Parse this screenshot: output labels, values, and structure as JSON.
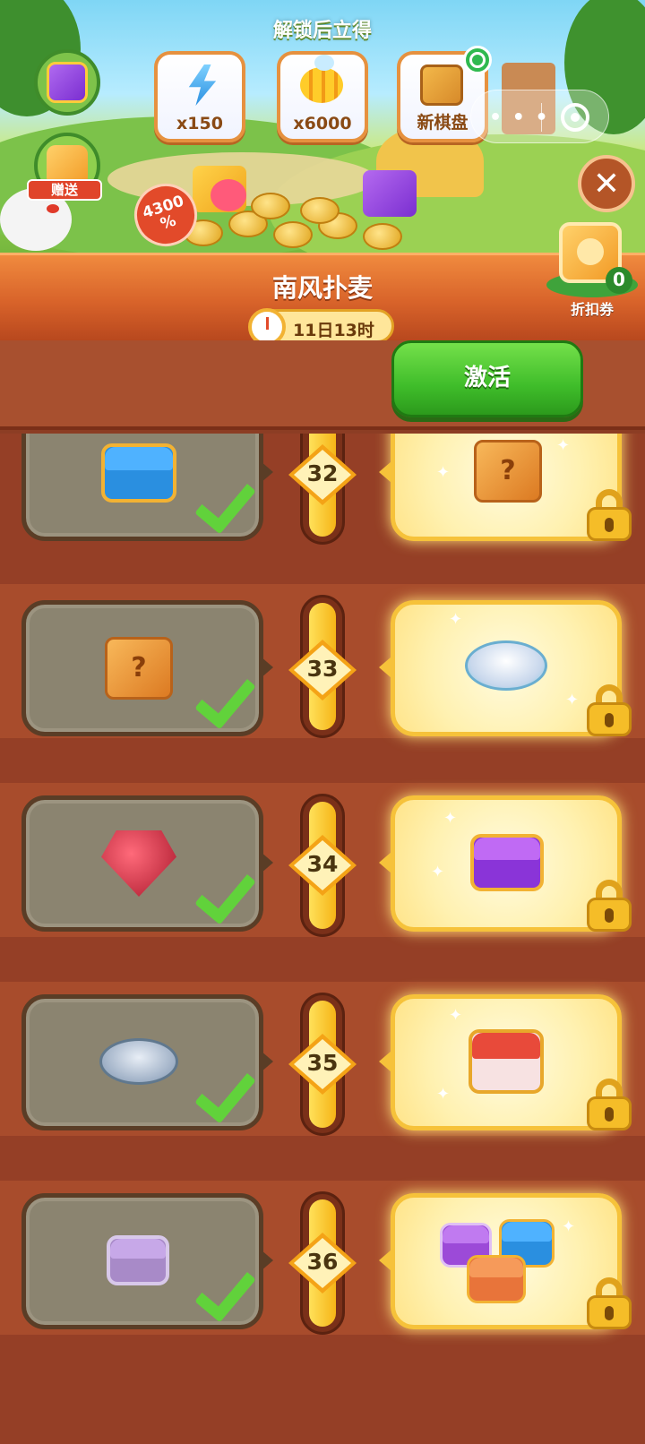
{
  "hero": {
    "unlock_title": "解锁后立得",
    "rewards": [
      {
        "icon": "lightning-icon",
        "qty": "x150"
      },
      {
        "icon": "bee-icon",
        "qty": "x6000"
      },
      {
        "icon": "board-icon",
        "qty": "新棋盘"
      }
    ],
    "gift_label": "赠送",
    "discount_badge_line1": "4300",
    "discount_badge_line2": "%"
  },
  "event": {
    "title": "南风扑麦",
    "timer": "11日13时",
    "activate_label": "激活"
  },
  "coupon": {
    "count": "0",
    "label": "折扣券"
  },
  "colors": {
    "accent_green": "#3fbd2a",
    "banner_orange": "#d8632a",
    "track_bg": "#953f26",
    "gold": "#f5b417"
  },
  "levels": [
    {
      "num": "32",
      "free_item": "blue-chest",
      "free_claimed": true,
      "paid_item": "mystery-box",
      "paid_locked": true
    },
    {
      "num": "33",
      "free_item": "mystery-box",
      "free_claimed": true,
      "paid_item": "flower-bowl",
      "paid_locked": true
    },
    {
      "num": "34",
      "free_item": "ruby-gem",
      "free_claimed": true,
      "paid_item": "purple-chest",
      "paid_locked": true
    },
    {
      "num": "35",
      "free_item": "flower-bowl",
      "free_claimed": true,
      "paid_item": "red-mystery-chest",
      "paid_locked": true
    },
    {
      "num": "36",
      "free_item": "purple-star-chest",
      "free_claimed": true,
      "paid_item": "chest-bundle",
      "paid_locked": true
    }
  ]
}
